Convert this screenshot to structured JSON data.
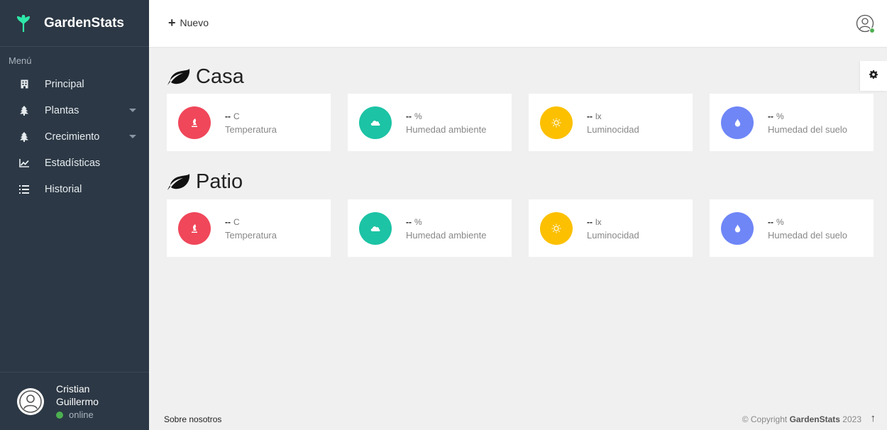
{
  "brand": {
    "name": "GardenStats"
  },
  "sidebar": {
    "menu_title": "Menú",
    "items": [
      {
        "label": "Principal",
        "icon": "building-icon",
        "has_caret": false
      },
      {
        "label": "Plantas",
        "icon": "tree-icon",
        "has_caret": true
      },
      {
        "label": "Crecimiento",
        "icon": "tree-icon",
        "has_caret": true
      },
      {
        "label": "Estadísticas",
        "icon": "chart-line-icon",
        "has_caret": false
      },
      {
        "label": "Historial",
        "icon": "list-icon",
        "has_caret": false
      }
    ],
    "user": {
      "first_name": "Cristian",
      "last_name": "Guillermo",
      "status": "online"
    }
  },
  "header": {
    "new_label": "Nuevo"
  },
  "sections": [
    {
      "title": "Casa",
      "cards": [
        {
          "value": "--",
          "unit": "C",
          "label": "Temperatura",
          "icon": "thermometer-icon",
          "color": "#f0475a"
        },
        {
          "value": "--",
          "unit": "%",
          "label": "Humedad ambiente",
          "icon": "cloud-icon",
          "color": "#1cc3a5"
        },
        {
          "value": "--",
          "unit": "lx",
          "label": "Luminocidad",
          "icon": "sun-icon",
          "color": "#fcc000"
        },
        {
          "value": "--",
          "unit": "%",
          "label": "Humedad del suelo",
          "icon": "water-drop-icon",
          "color": "#6f86f7"
        }
      ]
    },
    {
      "title": "Patio",
      "cards": [
        {
          "value": "--",
          "unit": "C",
          "label": "Temperatura",
          "icon": "thermometer-icon",
          "color": "#f0475a"
        },
        {
          "value": "--",
          "unit": "%",
          "label": "Humedad ambiente",
          "icon": "cloud-icon",
          "color": "#1cc3a5"
        },
        {
          "value": "--",
          "unit": "lx",
          "label": "Luminocidad",
          "icon": "sun-icon",
          "color": "#fcc000"
        },
        {
          "value": "--",
          "unit": "%",
          "label": "Humedad del suelo",
          "icon": "water-drop-icon",
          "color": "#6f86f7"
        }
      ]
    }
  ],
  "footer": {
    "about": "Sobre nosotros",
    "copyright_prefix": "© Copyright",
    "copyright_brand": "GardenStats",
    "copyright_year": "2023"
  }
}
